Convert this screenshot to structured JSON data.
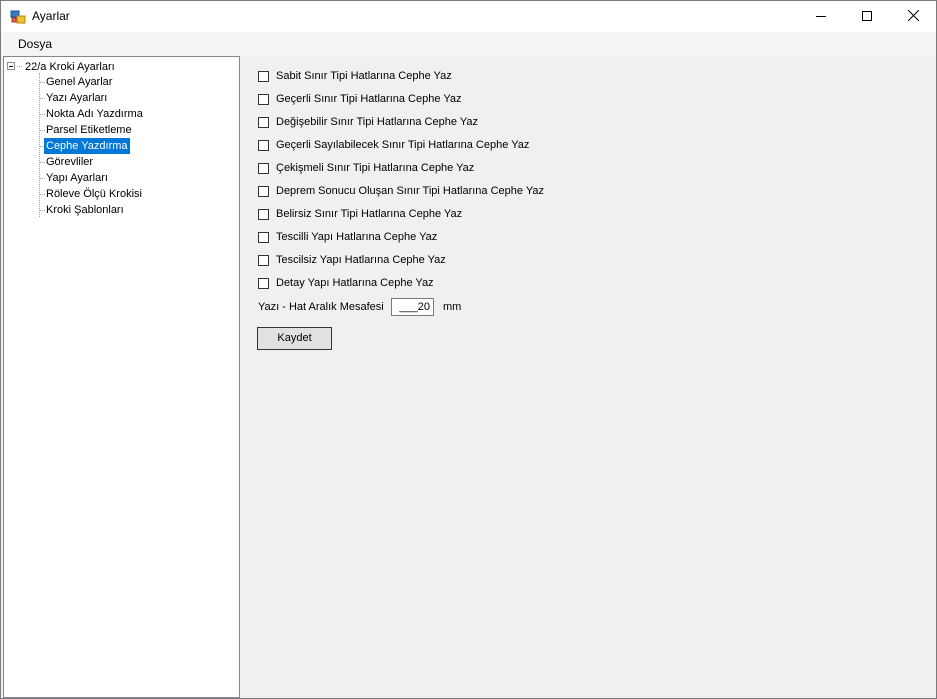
{
  "window": {
    "title": "Ayarlar",
    "icon": "app-settings-icon",
    "caption_buttons": [
      "minimize-icon",
      "maximize-icon",
      "close-icon"
    ]
  },
  "menu": {
    "items": [
      {
        "label": "Dosya"
      }
    ]
  },
  "tree": {
    "root": {
      "label": "22/a Kroki Ayarları",
      "expanded": true
    },
    "children": [
      {
        "label": "Genel Ayarlar"
      },
      {
        "label": "Yazı Ayarları"
      },
      {
        "label": "Nokta Adı Yazdırma"
      },
      {
        "label": "Parsel Etiketleme"
      },
      {
        "label": "Cephe Yazdırma",
        "selected": true
      },
      {
        "label": "Görevliler"
      },
      {
        "label": "Yapı Ayarları"
      },
      {
        "label": "Röleve Ölçü Krokisi"
      },
      {
        "label": "Kroki Şablonları"
      }
    ]
  },
  "content": {
    "checkboxes": [
      {
        "label": "Sabit Sınır Tipi Hatlarına Cephe Yaz",
        "checked": false
      },
      {
        "label": "Geçerli Sınır Tipi Hatlarına Cephe Yaz",
        "checked": false
      },
      {
        "label": "Değişebilir Sınır Tipi Hatlarına Cephe Yaz",
        "checked": false
      },
      {
        "label": "Geçerli Sayılabilecek Sınır Tipi Hatlarına Cephe Yaz",
        "checked": false
      },
      {
        "label": "Çekişmeli Sınır Tipi Hatlarına Cephe Yaz",
        "checked": false
      },
      {
        "label": "Deprem Sonucu Oluşan Sınır Tipi Hatlarına Cephe Yaz",
        "checked": false
      },
      {
        "label": "Belirsiz Sınır Tipi Hatlarına Cephe Yaz",
        "checked": false
      },
      {
        "label": "Tescilli Yapı Hatlarına Cephe Yaz",
        "checked": false
      },
      {
        "label": "Tescilsiz Yapı Hatlarına Cephe Yaz",
        "checked": false
      },
      {
        "label": "Detay Yapı Hatlarına Cephe Yaz",
        "checked": false
      }
    ],
    "spacing": {
      "label": "Yazı - Hat Aralık Mesafesi",
      "value": "___20",
      "unit": "mm"
    },
    "save_button": "Kaydet"
  },
  "colors": {
    "selection": "#0078d7",
    "window_bg": "#f0f0f0",
    "title_bg": "#ffffff"
  }
}
